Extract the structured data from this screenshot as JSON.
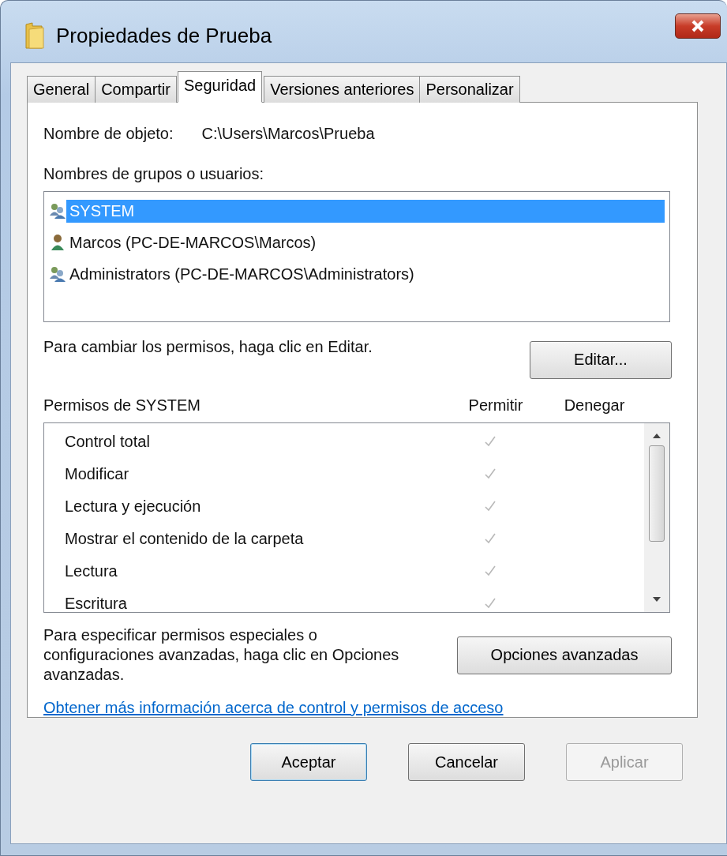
{
  "window": {
    "title": "Propiedades de Prueba"
  },
  "tabs": [
    {
      "label": "General",
      "selected": false
    },
    {
      "label": "Compartir",
      "selected": false
    },
    {
      "label": "Seguridad",
      "selected": true
    },
    {
      "label": "Versiones anteriores",
      "selected": false
    },
    {
      "label": "Personalizar",
      "selected": false
    }
  ],
  "object_name": {
    "label": "Nombre de objeto:",
    "value": "C:\\Users\\Marcos\\Prueba"
  },
  "users_label": "Nombres de grupos o usuarios:",
  "users": [
    {
      "kind": "group",
      "name": "SYSTEM",
      "selected": true
    },
    {
      "kind": "user",
      "name": "Marcos (PC-DE-MARCOS\\Marcos)",
      "selected": false
    },
    {
      "kind": "group",
      "name": "Administrators (PC-DE-MARCOS\\Administrators)",
      "selected": false
    }
  ],
  "edit_hint": "Para cambiar los permisos, haga clic en Editar.",
  "edit_button": "Editar...",
  "permissions_header": {
    "title": "Permisos de SYSTEM",
    "allow": "Permitir",
    "deny": "Denegar"
  },
  "permissions": [
    {
      "name": "Control total",
      "allow": true,
      "deny": false
    },
    {
      "name": "Modificar",
      "allow": true,
      "deny": false
    },
    {
      "name": "Lectura y ejecución",
      "allow": true,
      "deny": false
    },
    {
      "name": "Mostrar el contenido de la carpeta",
      "allow": true,
      "deny": false
    },
    {
      "name": "Lectura",
      "allow": true,
      "deny": false
    },
    {
      "name": "Escritura",
      "allow": true,
      "deny": false
    }
  ],
  "advanced_hint": "Para especificar permisos especiales o configuraciones avanzadas, haga clic en Opciones avanzadas.",
  "advanced_button": "Opciones avanzadas",
  "help_link": "Obtener más información acerca de control y permisos de acceso",
  "buttons": [
    {
      "label": "Aceptar",
      "kind": "default",
      "disabled": false
    },
    {
      "label": "Cancelar",
      "kind": "normal",
      "disabled": false
    },
    {
      "label": "Aplicar",
      "kind": "normal",
      "disabled": true
    }
  ]
}
